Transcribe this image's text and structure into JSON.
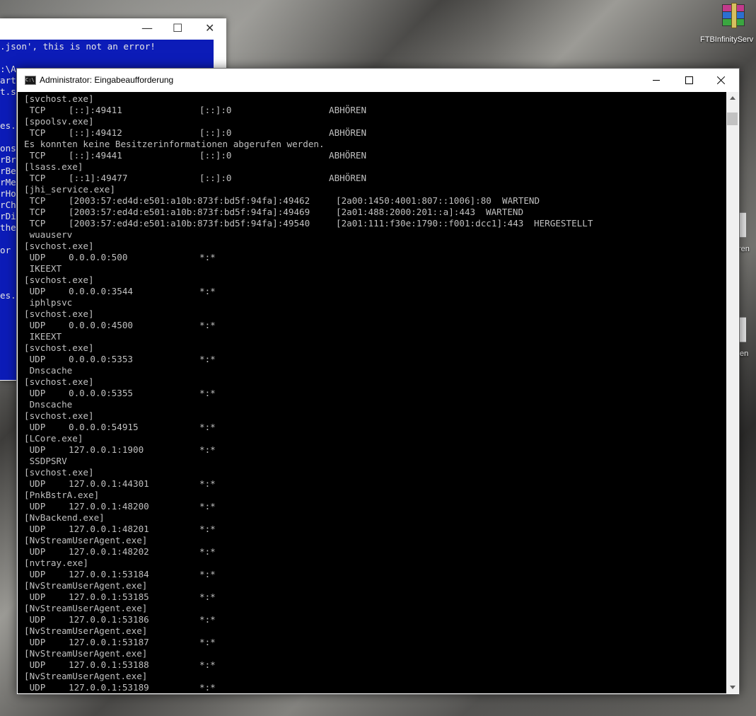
{
  "desktop": {
    "icons": [
      {
        "label": "FTBInfinityServ"
      },
      {
        "label": "ren"
      },
      {
        "label": "en"
      }
    ]
  },
  "back_window": {
    "lines": [
      ".json', this is not an error!",
      "",
      ":\\A",
      "art",
      "t.s",
      "",
      "",
      "es.",
      "",
      "ons",
      "rBr",
      "rBe",
      "rMe",
      "rHo",
      "rCh",
      "rDi",
      "the",
      "",
      "or",
      "",
      "",
      "",
      "es."
    ]
  },
  "cmd_window": {
    "title": "Administrator: Eingabeaufforderung",
    "icon": "console-icon",
    "lines": [
      {
        "text": "[svchost.exe]"
      },
      {
        "cols": [
          " TCP",
          "[::]:49411",
          "[::]:0",
          "ABHÖREN"
        ]
      },
      {
        "text": "[spoolsv.exe]"
      },
      {
        "cols": [
          " TCP",
          "[::]:49412",
          "[::]:0",
          "ABHÖREN"
        ]
      },
      {
        "text": "Es konnten keine Besitzerinformationen abgerufen werden."
      },
      {
        "cols": [
          " TCP",
          "[::]:49441",
          "[::]:0",
          "ABHÖREN"
        ]
      },
      {
        "text": "[lsass.exe]"
      },
      {
        "cols": [
          " TCP",
          "[::1]:49477",
          "[::]:0",
          "ABHÖREN"
        ]
      },
      {
        "text": "[jhi_service.exe]"
      },
      {
        "wide": [
          " TCP",
          "[2003:57:ed4d:e501:a10b:873f:bd5f:94fa]:49462",
          "[2a00:1450:4001:807::1006]:80",
          "WARTEND"
        ]
      },
      {
        "wide": [
          " TCP",
          "[2003:57:ed4d:e501:a10b:873f:bd5f:94fa]:49469",
          "[2a01:488:2000:201::a]:443",
          "WARTEND"
        ]
      },
      {
        "wide": [
          " TCP",
          "[2003:57:ed4d:e501:a10b:873f:bd5f:94fa]:49540",
          "[2a01:111:f30e:1790::f001:dcc1]:443",
          "HERGESTELLT"
        ]
      },
      {
        "text": " wuauserv"
      },
      {
        "text": "[svchost.exe]"
      },
      {
        "cols": [
          " UDP",
          "0.0.0.0:500",
          "*:*",
          ""
        ]
      },
      {
        "text": " IKEEXT"
      },
      {
        "text": "[svchost.exe]"
      },
      {
        "cols": [
          " UDP",
          "0.0.0.0:3544",
          "*:*",
          ""
        ]
      },
      {
        "text": " iphlpsvc"
      },
      {
        "text": "[svchost.exe]"
      },
      {
        "cols": [
          " UDP",
          "0.0.0.0:4500",
          "*:*",
          ""
        ]
      },
      {
        "text": " IKEEXT"
      },
      {
        "text": "[svchost.exe]"
      },
      {
        "cols": [
          " UDP",
          "0.0.0.0:5353",
          "*:*",
          ""
        ]
      },
      {
        "text": " Dnscache"
      },
      {
        "text": "[svchost.exe]"
      },
      {
        "cols": [
          " UDP",
          "0.0.0.0:5355",
          "*:*",
          ""
        ]
      },
      {
        "text": " Dnscache"
      },
      {
        "text": "[svchost.exe]"
      },
      {
        "cols": [
          " UDP",
          "0.0.0.0:54915",
          "*:*",
          ""
        ]
      },
      {
        "text": "[LCore.exe]"
      },
      {
        "cols": [
          " UDP",
          "127.0.0.1:1900",
          "*:*",
          ""
        ]
      },
      {
        "text": " SSDPSRV"
      },
      {
        "text": "[svchost.exe]"
      },
      {
        "cols": [
          " UDP",
          "127.0.0.1:44301",
          "*:*",
          ""
        ]
      },
      {
        "text": "[PnkBstrA.exe]"
      },
      {
        "cols": [
          " UDP",
          "127.0.0.1:48200",
          "*:*",
          ""
        ]
      },
      {
        "text": "[NvBackend.exe]"
      },
      {
        "cols": [
          " UDP",
          "127.0.0.1:48201",
          "*:*",
          ""
        ]
      },
      {
        "text": "[NvStreamUserAgent.exe]"
      },
      {
        "cols": [
          " UDP",
          "127.0.0.1:48202",
          "*:*",
          ""
        ]
      },
      {
        "text": "[nvtray.exe]"
      },
      {
        "cols": [
          " UDP",
          "127.0.0.1:53184",
          "*:*",
          ""
        ]
      },
      {
        "text": "[NvStreamUserAgent.exe]"
      },
      {
        "cols": [
          " UDP",
          "127.0.0.1:53185",
          "*:*",
          ""
        ]
      },
      {
        "text": "[NvStreamUserAgent.exe]"
      },
      {
        "cols": [
          " UDP",
          "127.0.0.1:53186",
          "*:*",
          ""
        ]
      },
      {
        "text": "[NvStreamUserAgent.exe]"
      },
      {
        "cols": [
          " UDP",
          "127.0.0.1:53187",
          "*:*",
          ""
        ]
      },
      {
        "text": "[NvStreamUserAgent.exe]"
      },
      {
        "cols": [
          " UDP",
          "127.0.0.1:53188",
          "*:*",
          ""
        ]
      },
      {
        "text": "[NvStreamUserAgent.exe]"
      },
      {
        "cols": [
          " UDP",
          "127.0.0.1:53189",
          "*:*",
          ""
        ]
      }
    ]
  },
  "colors": {
    "console_bg": "#000000",
    "console_fg": "#c0c0c0",
    "back_console_bg": "#0c1cb8"
  }
}
